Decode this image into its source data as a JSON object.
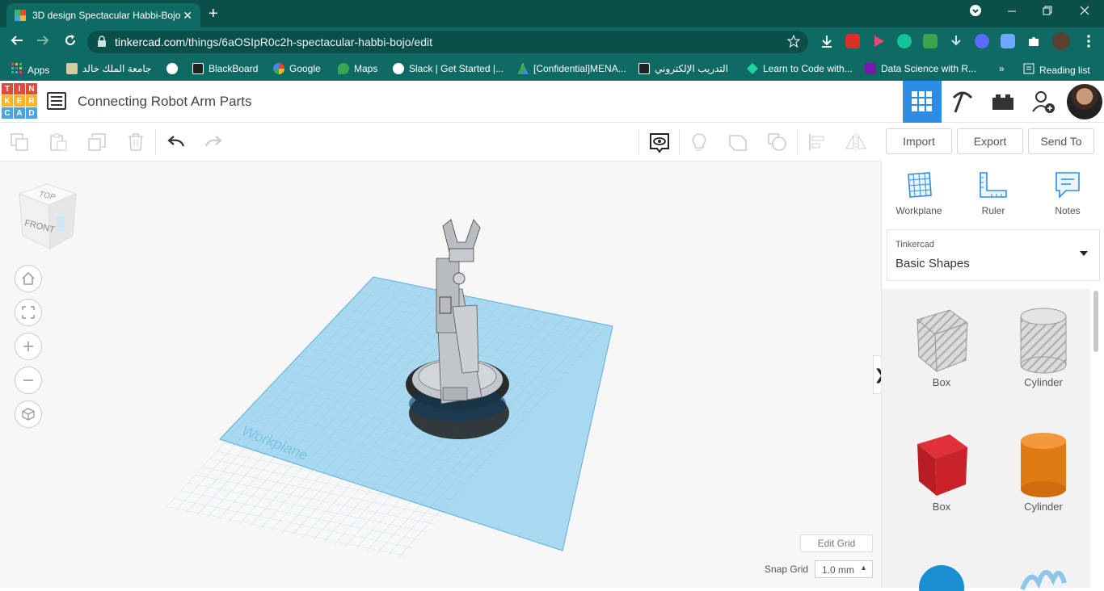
{
  "browser": {
    "tab_title": "3D design Spectacular Habbi-Bojo",
    "tab_close": "✕",
    "new_tab": "+",
    "url_host": "tinkercad.com",
    "url_path": "/things/6aOSIpR0c2h-spectacular-habbi-bojo/edit",
    "bookmarks": [
      {
        "label": "Apps",
        "icon": "apps-grid-icon"
      },
      {
        "label": "جامعة الملك خالد",
        "icon": "kku-icon"
      },
      {
        "label": "",
        "icon": "globe-icon"
      },
      {
        "label": "BlackBoard",
        "icon": "blackboard-icon"
      },
      {
        "label": "Google",
        "icon": "google-icon"
      },
      {
        "label": "Maps",
        "icon": "maps-icon"
      },
      {
        "label": "Slack | Get Started |...",
        "icon": "globe-icon"
      },
      {
        "label": "[Confidential]MENA...",
        "icon": "drive-icon"
      },
      {
        "label": "التدريب الإلكتروني",
        "icon": "blackboard-icon"
      },
      {
        "label": "Learn to Code with...",
        "icon": "codecademy-icon"
      },
      {
        "label": "Data Science with R...",
        "icon": "onenote-icon"
      }
    ],
    "more_bookmarks": "»",
    "reading_list": "Reading list"
  },
  "app": {
    "logo_letters": [
      "T",
      "I",
      "N",
      "K",
      "E",
      "R",
      "C",
      "A",
      "D"
    ],
    "logo_colors": [
      "#e24b3b",
      "#e24b3b",
      "#e24b3b",
      "#f7b32b",
      "#f7b32b",
      "#f7b32b",
      "#4aa3df",
      "#4aa3df",
      "#4aa3df"
    ],
    "project_title": "Connecting Robot Arm Parts",
    "accent": "#2f8ce6"
  },
  "toolbar": {
    "import_label": "Import",
    "export_label": "Export",
    "send_to_label": "Send To"
  },
  "viewcube": {
    "top": "TOP",
    "front": "FRONT"
  },
  "canvas": {
    "workplane_label": "Workplane",
    "edit_grid": "Edit Grid",
    "snap_grid_label": "Snap Grid",
    "snap_grid_value": "1.0 mm"
  },
  "right_panel": {
    "tools": [
      {
        "label": "Workplane",
        "icon": "workplane-icon"
      },
      {
        "label": "Ruler",
        "icon": "ruler-icon"
      },
      {
        "label": "Notes",
        "icon": "notes-icon"
      }
    ],
    "library_source": "Tinkercad",
    "library_name": "Basic Shapes",
    "shapes": [
      {
        "label": "Box",
        "icon": "box-hole-icon"
      },
      {
        "label": "Cylinder",
        "icon": "cylinder-hole-icon"
      },
      {
        "label": "Box",
        "icon": "box-red-icon"
      },
      {
        "label": "Cylinder",
        "icon": "cylinder-orange-icon"
      }
    ],
    "collapse": "❯"
  }
}
